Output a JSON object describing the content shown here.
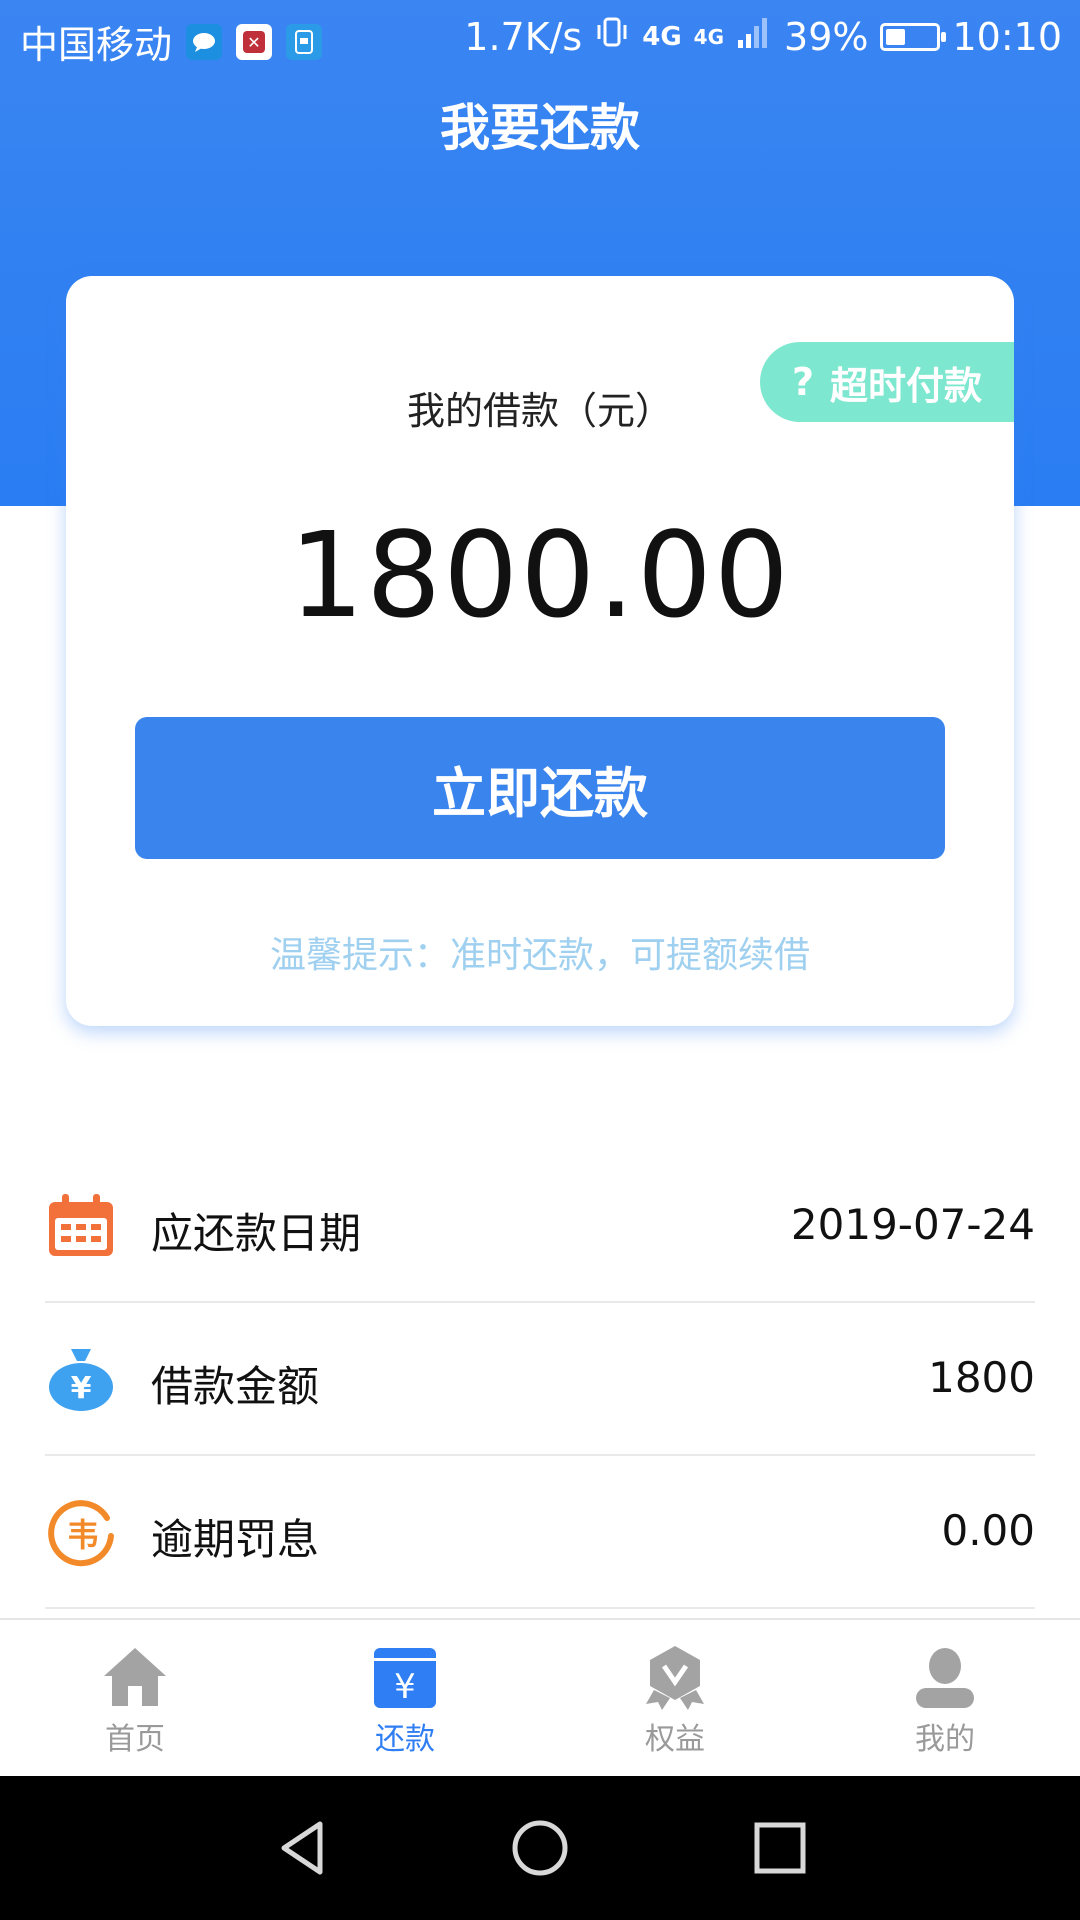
{
  "status_bar": {
    "carrier": "中国移动",
    "network_speed": "1.7K/s",
    "network_type_1": "4G",
    "network_type_2": "4G",
    "battery_percent": "39%",
    "battery_level": 0.39,
    "time": "10:10"
  },
  "header": {
    "title": "我要还款"
  },
  "card": {
    "overdue_tag_icon": "?",
    "overdue_tag_label": "超时付款",
    "loan_label": "我的借款（元）",
    "loan_amount": "1800.00",
    "repay_button": "立即还款",
    "tip": "温馨提示：准时还款，可提额续借"
  },
  "info_rows": [
    {
      "label": "应还款日期",
      "value": "2019-07-24",
      "icon": "calendar-icon",
      "color": "#f2703a"
    },
    {
      "label": "借款金额",
      "value": "1800",
      "icon": "money-bag-icon",
      "color": "#3ea2f0"
    },
    {
      "label": "逾期罚息",
      "value": "0.00",
      "icon": "penalty-icon",
      "color": "#f28a2a"
    }
  ],
  "tabbar": {
    "items": [
      {
        "label": "首页",
        "icon": "home-icon",
        "active": false
      },
      {
        "label": "还款",
        "icon": "repay-icon",
        "active": true
      },
      {
        "label": "权益",
        "icon": "rights-badge-icon",
        "active": false
      },
      {
        "label": "我的",
        "icon": "profile-icon",
        "active": false
      }
    ]
  },
  "colors": {
    "primary": "#3a84ee",
    "tag": "#7de7cf",
    "tip": "#9fd0f0",
    "tab_active": "#2f7ef3",
    "tab_inactive": "#9a9a9a"
  }
}
